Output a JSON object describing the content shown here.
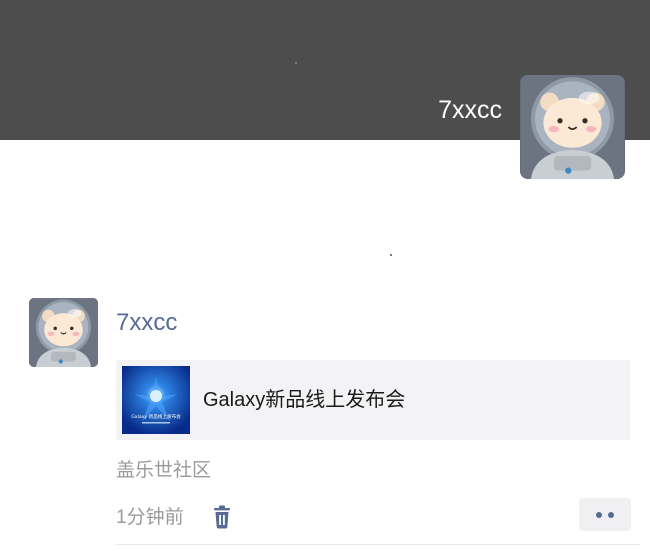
{
  "profile": {
    "nickname": "7xxcc",
    "avatar_icon": "bear-astronaut-avatar"
  },
  "post": {
    "author": "7xxcc",
    "share_card": {
      "title": "Galaxy新品线上发布会",
      "thumbnail_icon": "galaxy-event-thumbnail",
      "thumbnail_text": "Galaxy 新品线上发布会"
    },
    "source": "盖乐世社区",
    "time": "1分钟前",
    "delete_icon": "trash-icon",
    "more_icon": "more-dots-icon"
  },
  "colors": {
    "cover_bg": "#4d4d4d",
    "link_blue": "#576b95",
    "gray_text": "#9a9a9a",
    "card_bg": "#f3f3f5"
  }
}
